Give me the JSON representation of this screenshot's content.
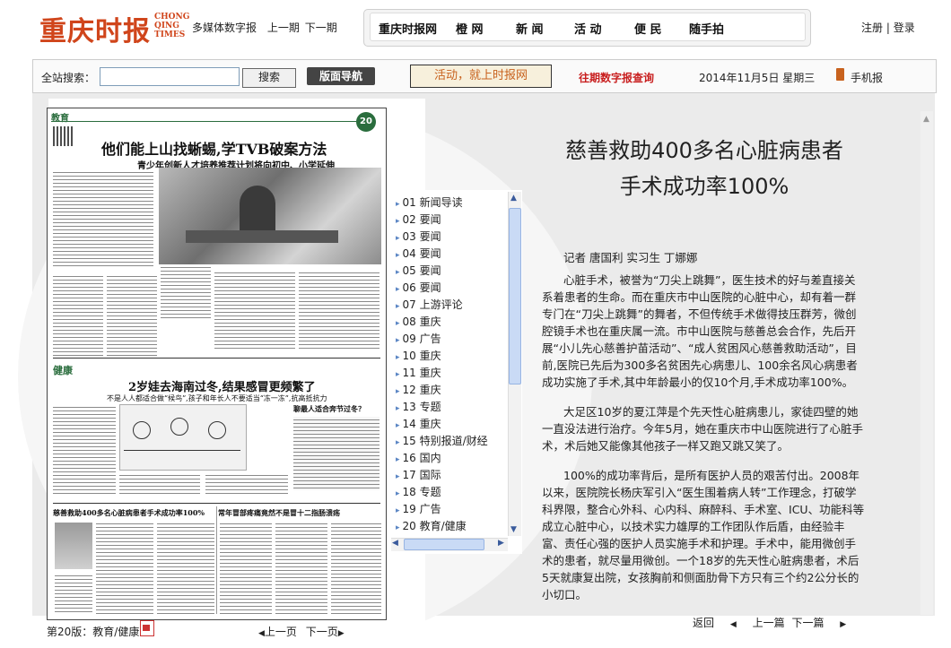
{
  "header": {
    "logo_cn": "重庆时报",
    "logo_en": "CHONG QING TIMES",
    "digital_label": "多媒体数字报",
    "prev_issue": "上一期",
    "next_issue": "下一期",
    "nav": [
      "重庆时报网",
      "橙 网",
      "新 闻",
      "活 动",
      "便 民",
      "随手拍"
    ],
    "register": "注册",
    "login": "登录"
  },
  "searchbar": {
    "label": "全站搜索：",
    "input_value": "",
    "search_button": "搜索",
    "layout_nav_button": "版面导航",
    "promo_button": "活动，就上时报网",
    "archive_link": "往期数字报查询",
    "date": "2014年11月5日 星期三",
    "mobile_label": "手机报"
  },
  "newspaper": {
    "section_tag": "教育",
    "page_number": "20",
    "headline1": "他们能上山找蜥蜴,学TVB破案方法",
    "subhead1": "青少年创新人才培养推荐计划将向初中、小学延伸",
    "section2_tag": "健康",
    "headline2": "2岁娃去海南过冬,结果感冒更频繁了",
    "subhead2": "不是人人都适合做“候鸟”,孩子和年长人不要适当“冻一冻”,抗高抵抗力",
    "headline3": "慈善救助400多名心脏病患者手术成功率100%",
    "headline4": "常年冒部疼痛竟然不是冒十二指肠溃疡",
    "sidebar_title": "聊最人适合奔节过冬？"
  },
  "sections": [
    "01 新闻导读",
    "02 要闻",
    "03 要闻",
    "04 要闻",
    "05 要闻",
    "06 要闻",
    "07 上游评论",
    "08 重庆",
    "09 广告",
    "10 重庆",
    "11 重庆",
    "12 重庆",
    "13 专题",
    "14 重庆",
    "15 特别报道/财经",
    "16 国内",
    "17 国际",
    "18 专题",
    "19 广告",
    "20 教育/健康"
  ],
  "article": {
    "title_line1": "慈善救助400多名心脏病患者",
    "title_line2": "手术成功率100%",
    "byline": "记者 唐国利 实习生 丁娜娜",
    "paragraphs": [
      "心脏手术，被誉为“刀尖上跳舞”，医生技术的好与差直接关系着患者的生命。而在重庆市中山医院的心脏中心，却有着一群专门在“刀尖上跳舞”的舞者，不但传统手术做得技压群芳，微创腔镜手术也在重庆属一流。市中山医院与慈善总会合作，先后开展“小儿先心慈善护苗活动”、“成人贫困风心慈善救助活动”，目前,医院已先后为300多名贫困先心病患儿、100余名风心病患者成功实施了手术,其中年龄最小的仅10个月,手术成功率100%。",
      "大足区10岁的夏江萍是个先天性心脏病患儿，家徒四壁的她一直没法进行治疗。今年5月，她在重庆市中山医院进行了心脏手术，术后她又能像其他孩子一样又跑又跳又笑了。",
      "100%的成功率背后，是所有医护人员的艰苦付出。2008年以来，医院院长杨庆军引入“医生围着病人转”工作理念，打破学科界限，整合心外科、心内科、麻醉科、手术室、ICU、功能科等成立心脏中心，以技术实力雄厚的工作团队作后盾，由经验丰富、责任心强的医护人员实施手术和护理。手术中，能用微创手术的患者，就尽量用微创。一个18岁的先天性心脏病患者，术后5天就康复出院，女孩胸前和侧面肋骨下方只有三个约2公分长的小切口。"
    ]
  },
  "footer": {
    "page_label": "第20版：教育/健康",
    "prev_page": "上一页",
    "next_page": "下一页",
    "back": "返回",
    "prev_article": "上一篇",
    "next_article": "下一篇"
  }
}
